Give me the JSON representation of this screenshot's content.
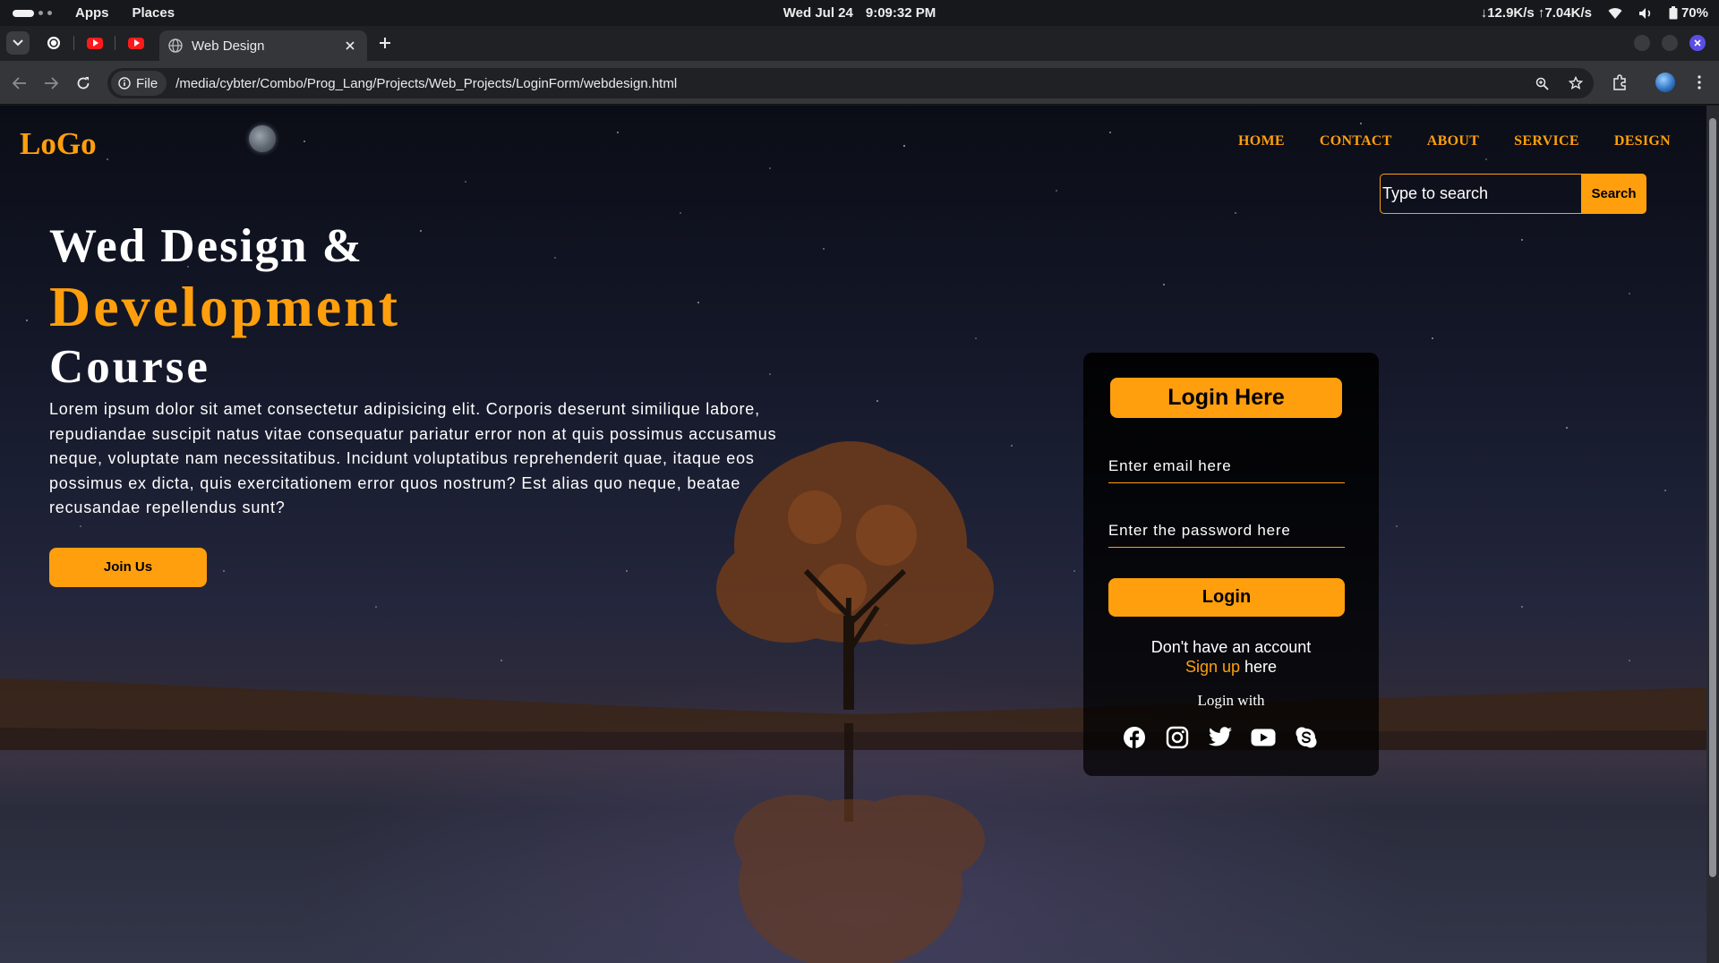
{
  "system_bar": {
    "apps_label": "Apps",
    "places_label": "Places",
    "date": "Wed Jul 24",
    "time": "9:09:32 PM",
    "net_speed": "↓12.9K/s ↑7.04K/s",
    "battery": "70%"
  },
  "browser": {
    "active_tab_title": "Web Design",
    "site_info_label": "File",
    "url": "/media/cybter/Combo/Prog_Lang/Projects/Web_Projects/LoginForm/webdesign.html"
  },
  "page": {
    "logo": "LoGo",
    "nav": [
      "HOME",
      "CONTACT",
      "ABOUT",
      "SERVICE",
      "DESIGN"
    ],
    "search": {
      "placeholder": "Type to search",
      "button": "Search"
    },
    "hero": {
      "line1": "Wed Design &",
      "line2": "Development",
      "line3": "Course",
      "paragraph": "Lorem ipsum dolor sit amet consectetur adipisicing elit. Corporis deserunt similique labore, repudiandae suscipit natus vitae consequatur pariatur error non at quis possimus accusamus neque, voluptate nam necessitatibus. Incidunt voluptatibus reprehenderit quae, itaque eos possimus ex dicta, quis exercitationem error quos nostrum? Est alias quo neque, beatae recusandae repellendus sunt?",
      "join_button": "Join Us"
    },
    "login_card": {
      "title": "Login Here",
      "email_placeholder": "Enter email here",
      "password_placeholder": "Enter the password here",
      "login_button": "Login",
      "no_account": "Don't have an account",
      "signup_link": "Sign up",
      "signup_suffix": " here",
      "login_with": "Login with",
      "social_icons": [
        "facebook-icon",
        "instagram-icon",
        "twitter-icon",
        "youtube-icon",
        "skype-icon"
      ]
    }
  },
  "colors": {
    "accent": "#ff9f0d",
    "card_bg": "#000000",
    "text": "#ffffff"
  }
}
